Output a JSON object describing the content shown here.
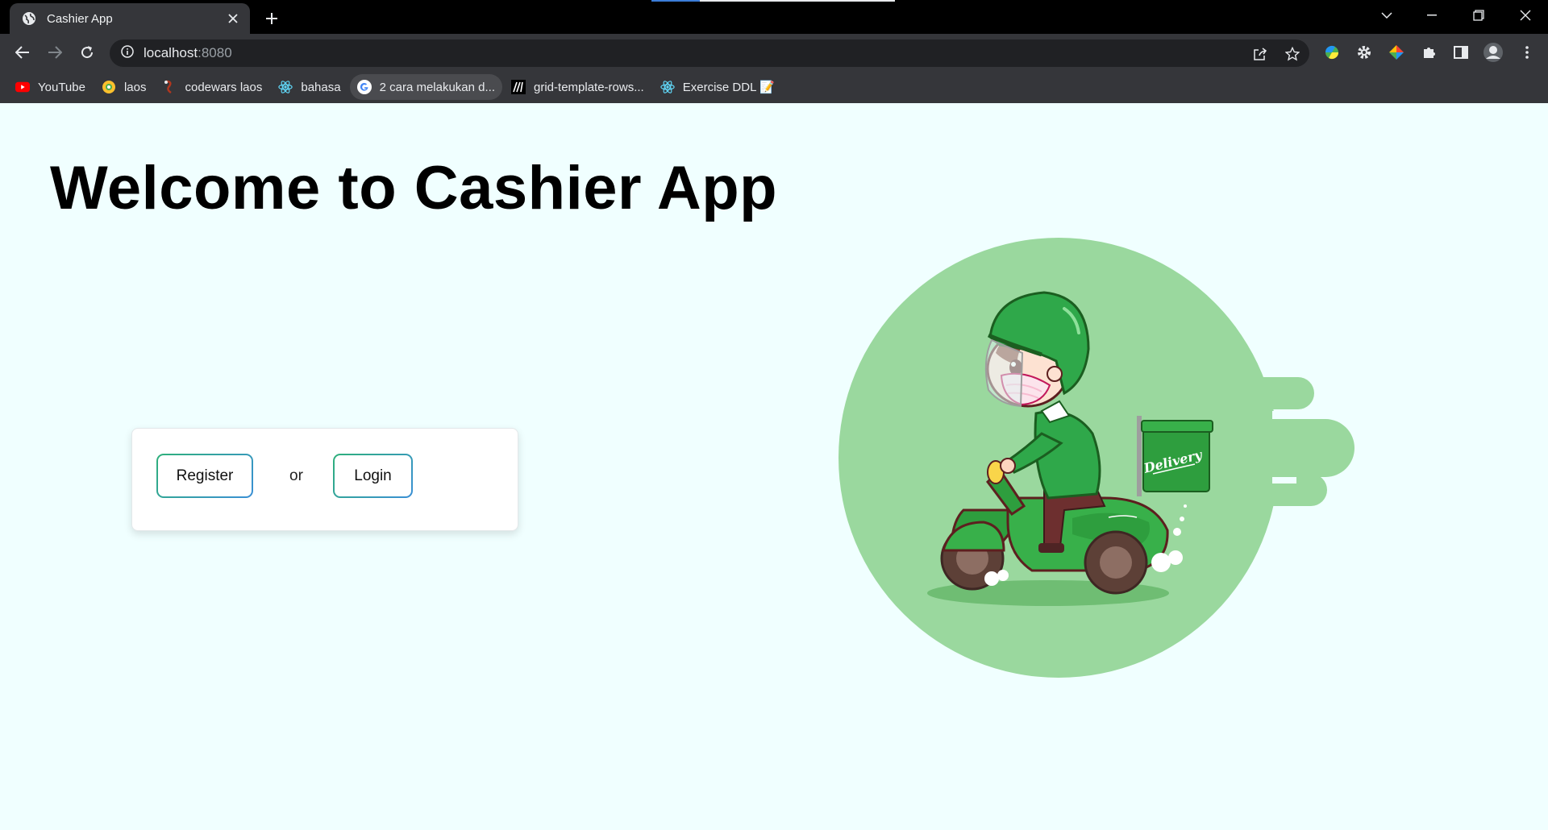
{
  "browser": {
    "tab": {
      "title": "Cashier App"
    },
    "address": {
      "host": "localhost",
      "port": ":8080"
    },
    "bookmarks": [
      {
        "label": "YouTube",
        "icon": "youtube-icon"
      },
      {
        "label": "laos",
        "icon": "chrome-web-icon"
      },
      {
        "label": "codewars laos",
        "icon": "codewars-icon"
      },
      {
        "label": "bahasa",
        "icon": "react-icon"
      },
      {
        "label": "2 cara melakukan d...",
        "icon": "google-icon"
      },
      {
        "label": "grid-template-rows...",
        "icon": "mdn-icon"
      },
      {
        "label": "Exercise DDL 📝",
        "icon": "react-icon"
      }
    ]
  },
  "page": {
    "heading": "Welcome to Cashier App",
    "register_label": "Register",
    "or_text": "or",
    "login_label": "Login",
    "illustration_text": "Delivery"
  },
  "colors": {
    "page_bg": "#f0ffff",
    "circle": "#9ad89e",
    "scooter": "#2e9e3e",
    "helmet": "#2fa84a"
  }
}
